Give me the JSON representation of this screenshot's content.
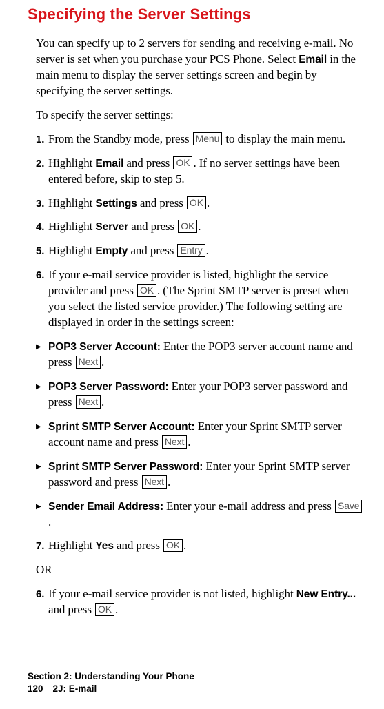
{
  "heading": "Specifying the Server Settings",
  "intro": "You can specify up to 2 servers for sending and receiving e-mail. No server is set when you purchase your PCS Phone. Select ",
  "intro_bold": "Email",
  "intro_after": " in the main menu to display the server settings screen and begin by specifying the server settings.",
  "lead": "To specify the server settings:",
  "keys": {
    "menu": "Menu",
    "ok": "OK",
    "entry": "Entry",
    "next": "Next",
    "save": "Save"
  },
  "steps": {
    "s1": {
      "num": "1.",
      "t1": "From the Standby mode, press ",
      "t2": " to display the main menu."
    },
    "s2": {
      "num": "2.",
      "t1": "Highlight ",
      "b": "Email",
      "t2": " and press ",
      "t3": ". If no server settings have been entered before, skip to step 5."
    },
    "s3": {
      "num": "3.",
      "t1": "Highlight ",
      "b": "Settings",
      "t2": " and press ",
      "t3": "."
    },
    "s4": {
      "num": "4.",
      "t1": "Highlight ",
      "b": "Server",
      "t2": " and press ",
      "t3": "."
    },
    "s5": {
      "num": "5.",
      "t1": "Highlight ",
      "b": "Empty",
      "t2": " and press ",
      "t3": "."
    },
    "s6": {
      "num": "6.",
      "t1": "If your e-mail service provider is listed, highlight the service provider and press ",
      "t2": ". (The Sprint SMTP server is preset when you select the listed service provider.) The following setting are displayed in order in the settings screen:"
    },
    "s7": {
      "num": "7.",
      "t1": "Highlight ",
      "b": "Yes",
      "t2": " and press ",
      "t3": "."
    },
    "s6b": {
      "num": "6.",
      "t1": "If your e-mail service provider is not listed, highlight ",
      "b": "New Entry...",
      "t2": " and press ",
      "t3": "."
    }
  },
  "bullets": {
    "b1": {
      "b": "POP3 Server Account:",
      "t1": " Enter the POP3 server account name and press ",
      "t2": "."
    },
    "b2": {
      "b": "POP3 Server Password:",
      "t1": " Enter your POP3 server password and press ",
      "t2": "."
    },
    "b3": {
      "b": "Sprint SMTP Server Account:",
      "t1": " Enter your Sprint SMTP server account name and press ",
      "t2": "."
    },
    "b4": {
      "b": "Sprint SMTP Server Password:",
      "t1": " Enter your Sprint SMTP server password and press ",
      "t2": "."
    },
    "b5": {
      "b": "Sender Email Address:",
      "t1": " Enter your e-mail address and press ",
      "t2": "."
    }
  },
  "or_text": "OR",
  "triangle": "▶",
  "footer": {
    "line1": "Section 2: Understanding Your Phone",
    "page": "120",
    "section": "2J: E-mail"
  }
}
